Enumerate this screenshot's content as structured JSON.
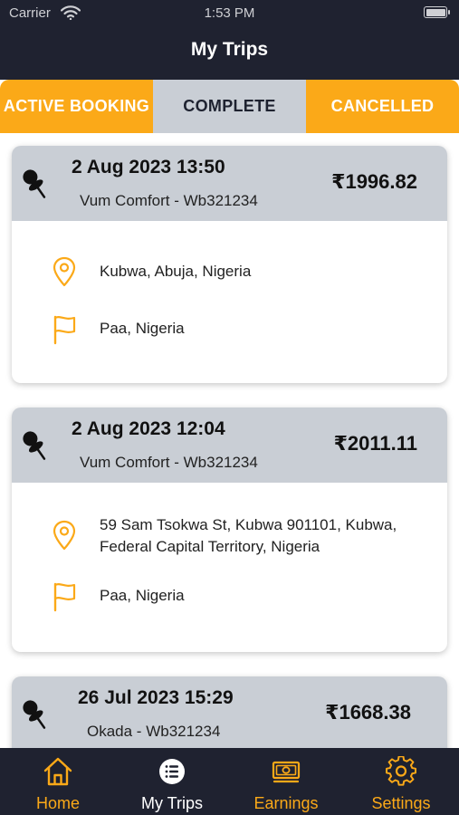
{
  "status_bar": {
    "carrier": "Carrier",
    "time": "1:53 PM"
  },
  "header": {
    "title": "My Trips"
  },
  "tabs": [
    {
      "label": "ACTIVE BOOKING"
    },
    {
      "label": "COMPLETE"
    },
    {
      "label": "CANCELLED"
    }
  ],
  "trips": [
    {
      "datetime": "2 Aug 2023 13:50",
      "vehicle": "Vum Comfort - Wb321234",
      "price": "₹1996.82",
      "pickup": "Kubwa, Abuja, Nigeria",
      "dropoff": "Paa, Nigeria"
    },
    {
      "datetime": "2 Aug 2023 12:04",
      "vehicle": "Vum Comfort - Wb321234",
      "price": "₹2011.11",
      "pickup": "59 Sam Tsokwa St, Kubwa 901101, Kubwa, Federal Capital Territory, Nigeria",
      "dropoff": "Paa, Nigeria"
    },
    {
      "datetime": "26 Jul 2023 15:29",
      "vehicle": "Okada - Wb321234",
      "price": "₹1668.38"
    }
  ],
  "bottom_nav": [
    {
      "label": "Home",
      "icon": "home-icon"
    },
    {
      "label": "My Trips",
      "icon": "list-icon"
    },
    {
      "label": "Earnings",
      "icon": "money-icon"
    },
    {
      "label": "Settings",
      "icon": "gear-icon"
    }
  ],
  "colors": {
    "accent": "#fba918",
    "dark": "#1f2230",
    "card_header": "#c9ced5"
  }
}
